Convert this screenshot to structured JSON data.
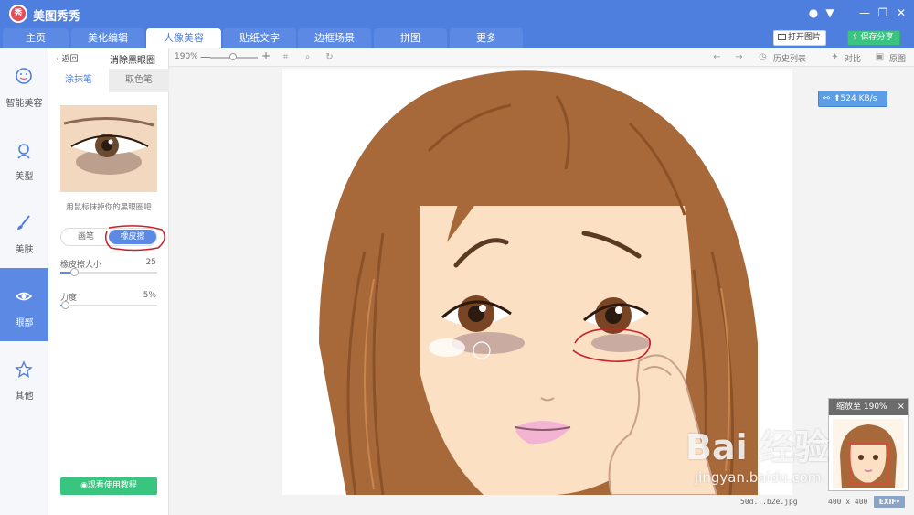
{
  "app": {
    "logo_glyph": "秀",
    "name": "美图秀秀"
  },
  "nav": {
    "tabs": [
      {
        "label": "主页"
      },
      {
        "label": "美化编辑"
      },
      {
        "label": "人像美容"
      },
      {
        "label": "贴纸文字"
      },
      {
        "label": "边框场景"
      },
      {
        "label": "拼图"
      },
      {
        "label": "更多"
      }
    ],
    "active_tab": "人像美容",
    "open_image_label": "打开图片",
    "save_share_label": "保存分享"
  },
  "sidebar": {
    "items": [
      {
        "label": "智能美容",
        "icon": "face-smile-icon"
      },
      {
        "label": "美型",
        "icon": "face-outline-icon"
      },
      {
        "label": "美肤",
        "icon": "brush-icon"
      },
      {
        "label": "眼部",
        "icon": "eye-icon"
      },
      {
        "label": "其他",
        "icon": "star-icon"
      }
    ],
    "active_item": "眼部"
  },
  "panel": {
    "back_label": "返回",
    "title": "消除黑眼圈",
    "tabs": [
      "涂抹笔",
      "取色笔"
    ],
    "hint": "用鼠标抹掉你的黑眼圈吧",
    "modes": [
      "画笔",
      "橡皮擦"
    ],
    "active_mode": "橡皮擦",
    "eraser_size": {
      "label": "橡皮擦大小",
      "value": "25",
      "fraction": 0.14
    },
    "strength": {
      "label": "力度",
      "value": "5%",
      "fraction": 0.05
    },
    "tutorial_label": "观看使用教程"
  },
  "toolbar": {
    "zoom_text": "190%",
    "zoom_fraction": 0.48,
    "history_label": "历史列表",
    "compare_label": "对比",
    "original_label": "原图"
  },
  "canvas": {
    "speed_badge": "524 KB/s",
    "file_name": "50d...b2e.jpg",
    "image_size": "400 x 400",
    "exif_label": "EXIF"
  },
  "navigator": {
    "title": "缩放至 190%",
    "close": "×"
  },
  "colors": {
    "accent": "#4f7fde",
    "save_green": "#39c47f",
    "hair": "#a8693a",
    "skin": "#fbe0c4",
    "annotation_red": "#c8202a"
  },
  "watermark": {
    "text": "Bai 经验",
    "sub": "jingyan.baidu.com"
  }
}
